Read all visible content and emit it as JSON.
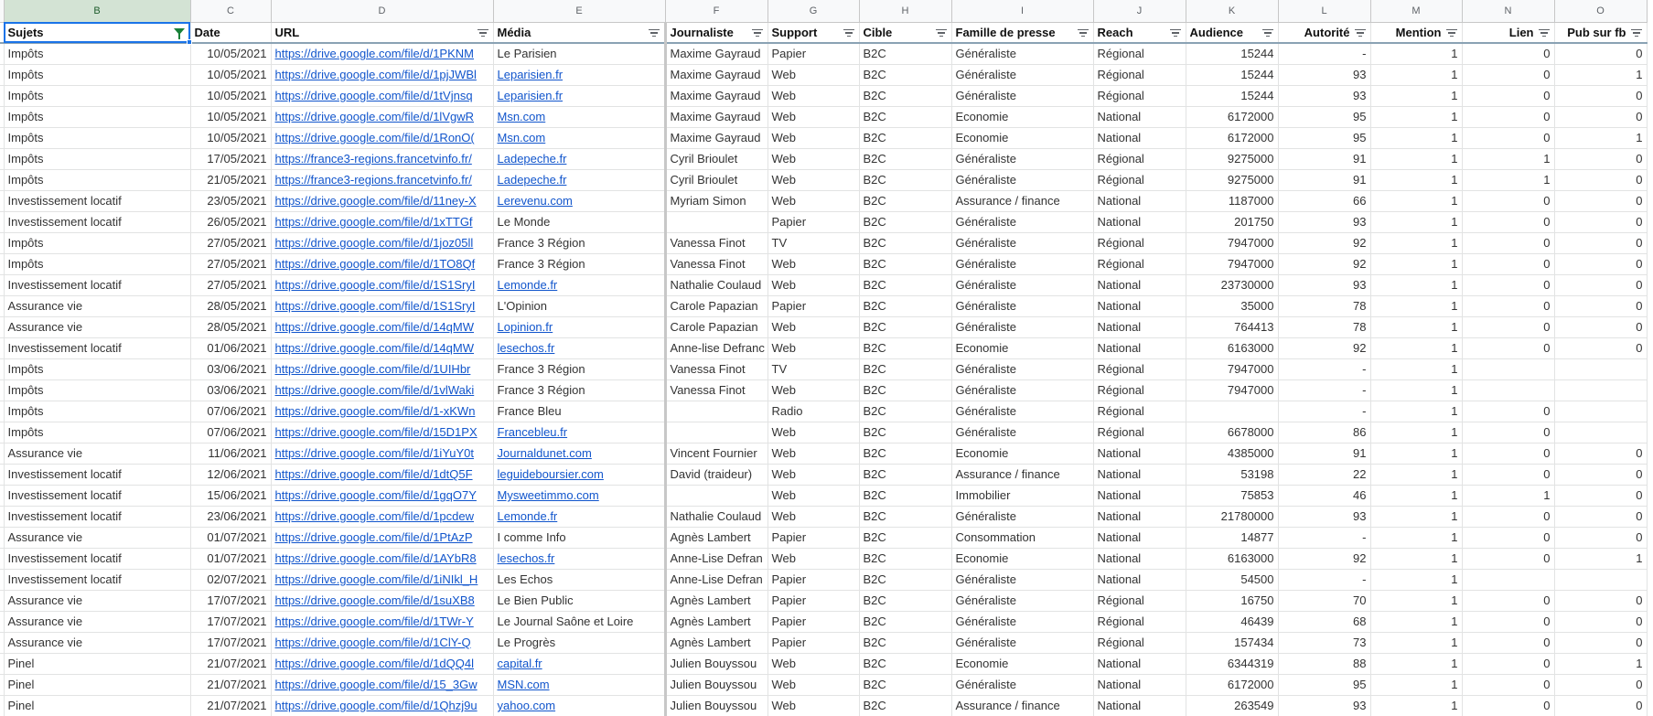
{
  "columns": [
    {
      "letter": "B",
      "header": "Sujets",
      "filter": "active"
    },
    {
      "letter": "C",
      "header": "Date",
      "filter": "none"
    },
    {
      "letter": "D",
      "header": "URL",
      "filter": "inactive"
    },
    {
      "letter": "E",
      "header": "Média",
      "filter": "inactive"
    },
    {
      "letter": "F",
      "header": "Journaliste",
      "filter": "inactive"
    },
    {
      "letter": "G",
      "header": "Support",
      "filter": "inactive"
    },
    {
      "letter": "H",
      "header": "Cible",
      "filter": "inactive"
    },
    {
      "letter": "I",
      "header": "Famille de presse",
      "filter": "inactive"
    },
    {
      "letter": "J",
      "header": "Reach",
      "filter": "inactive"
    },
    {
      "letter": "K",
      "header": "Audience",
      "filter": "inactive"
    },
    {
      "letter": "L",
      "header": "Autorité",
      "filter": "inactive"
    },
    {
      "letter": "M",
      "header": "Mention",
      "filter": "inactive"
    },
    {
      "letter": "N",
      "header": "Lien",
      "filter": "inactive"
    },
    {
      "letter": "O",
      "header": "Pub sur fb",
      "filter": "inactive"
    }
  ],
  "rows": [
    [
      "Impôts",
      "10/05/2021",
      "https://drive.google.com/file/d/1PKNM",
      "Le Parisien",
      "Maxime Gayraud",
      "Papier",
      "B2C",
      "Généraliste",
      "Régional",
      "15244",
      "-",
      "1",
      "0",
      "0"
    ],
    [
      "Impôts",
      "10/05/2021",
      "https://drive.google.com/file/d/1pjJWBl",
      "Leparisien.fr",
      "Maxime Gayraud",
      "Web",
      "B2C",
      "Généraliste",
      "Régional",
      "15244",
      "93",
      "1",
      "0",
      "1"
    ],
    [
      "Impôts",
      "10/05/2021",
      "https://drive.google.com/file/d/1tVjnsq",
      "Leparisien.fr",
      "Maxime Gayraud",
      "Web",
      "B2C",
      "Généraliste",
      "Régional",
      "15244",
      "93",
      "1",
      "0",
      "0"
    ],
    [
      "Impôts",
      "10/05/2021",
      "https://drive.google.com/file/d/1lVgwR",
      "Msn.com",
      "Maxime Gayraud",
      "Web",
      "B2C",
      "Economie",
      "National",
      "6172000",
      "95",
      "1",
      "0",
      "0"
    ],
    [
      "Impôts",
      "10/05/2021",
      "https://drive.google.com/file/d/1RonO(",
      "Msn.com",
      "Maxime Gayraud",
      "Web",
      "B2C",
      "Economie",
      "National",
      "6172000",
      "95",
      "1",
      "0",
      "1"
    ],
    [
      "Impôts",
      "17/05/2021",
      "https://france3-regions.francetvinfo.fr/",
      "Ladepeche.fr",
      "Cyril Brioulet",
      "Web",
      "B2C",
      "Généraliste",
      "Régional",
      "9275000",
      "91",
      "1",
      "1",
      "0"
    ],
    [
      "Impôts",
      "21/05/2021",
      "https://france3-regions.francetvinfo.fr/",
      "Ladepeche.fr",
      "Cyril Brioulet",
      "Web",
      "B2C",
      "Généraliste",
      "Régional",
      "9275000",
      "91",
      "1",
      "1",
      "0"
    ],
    [
      "Investissement locatif",
      "23/05/2021",
      "https://drive.google.com/file/d/11ney-X",
      "Lerevenu.com",
      "Myriam Simon",
      "Web",
      "B2C",
      "Assurance / finance",
      "National",
      "1187000",
      "66",
      "1",
      "0",
      "0"
    ],
    [
      "Investissement locatif",
      "26/05/2021",
      "https://drive.google.com/file/d/1xTTGf",
      "Le Monde",
      "",
      "Papier",
      "B2C",
      "Généraliste",
      "National",
      "201750",
      "93",
      "1",
      "0",
      "0"
    ],
    [
      "Impôts",
      "27/05/2021",
      "https://drive.google.com/file/d/1joz05ll",
      "France 3 Région",
      "Vanessa Finot",
      "TV",
      "B2C",
      "Généraliste",
      "Régional",
      "7947000",
      "92",
      "1",
      "0",
      "0"
    ],
    [
      "Impôts",
      "27/05/2021",
      "https://drive.google.com/file/d/1TO8Qf",
      "France 3 Région",
      "Vanessa Finot",
      "Web",
      "B2C",
      "Généraliste",
      "Régional",
      "7947000",
      "92",
      "1",
      "0",
      "0"
    ],
    [
      "Investissement locatif",
      "27/05/2021",
      "https://drive.google.com/file/d/1S1SryI",
      "Lemonde.fr",
      "Nathalie Coulaud",
      "Web",
      "B2C",
      "Généraliste",
      "National",
      "23730000",
      "93",
      "1",
      "0",
      "0"
    ],
    [
      "Assurance vie",
      "28/05/2021",
      "https://drive.google.com/file/d/1S1SryI",
      "L'Opinion",
      "Carole Papazian",
      "Papier",
      "B2C",
      "Généraliste",
      "National",
      "35000",
      "78",
      "1",
      "0",
      "0"
    ],
    [
      "Assurance vie",
      "28/05/2021",
      "https://drive.google.com/file/d/14qMW",
      "Lopinion.fr",
      "Carole Papazian",
      "Web",
      "B2C",
      "Généraliste",
      "National",
      "764413",
      "78",
      "1",
      "0",
      "0"
    ],
    [
      "Investissement locatif",
      "01/06/2021",
      "https://drive.google.com/file/d/14qMW",
      "lesechos.fr",
      "Anne-lise Defranc",
      "Web",
      "B2C",
      "Economie",
      "National",
      "6163000",
      "92",
      "1",
      "0",
      "0"
    ],
    [
      "Impôts",
      "03/06/2021",
      "https://drive.google.com/file/d/1UIHbr",
      "France 3 Région",
      "Vanessa Finot",
      "TV",
      "B2C",
      "Généraliste",
      "Régional",
      "7947000",
      "-",
      "1",
      "",
      ""
    ],
    [
      "Impôts",
      "03/06/2021",
      "https://drive.google.com/file/d/1vlWaki",
      "France 3 Région",
      "Vanessa Finot",
      "Web",
      "B2C",
      "Généraliste",
      "Régional",
      "7947000",
      "-",
      "1",
      "",
      ""
    ],
    [
      "Impôts",
      "07/06/2021",
      "https://drive.google.com/file/d/1-xKWn",
      "France Bleu",
      "",
      "Radio",
      "B2C",
      "Généraliste",
      "Régional",
      "",
      "-",
      "1",
      "0",
      ""
    ],
    [
      "Impôts",
      "07/06/2021",
      "https://drive.google.com/file/d/15D1PX",
      "Francebleu.fr",
      "",
      "Web",
      "B2C",
      "Généraliste",
      "Régional",
      "6678000",
      "86",
      "1",
      "0",
      ""
    ],
    [
      "Assurance vie",
      "11/06/2021",
      "https://drive.google.com/file/d/1iYuY0t",
      "Journaldunet.com",
      "Vincent Fournier",
      "Web",
      "B2C",
      "Economie",
      "National",
      "4385000",
      "91",
      "1",
      "0",
      "0"
    ],
    [
      "Investissement locatif",
      "12/06/2021",
      "https://drive.google.com/file/d/1dtQ5F",
      "leguideboursier.com",
      "David (traideur)",
      "Web",
      "B2C",
      "Assurance / finance",
      "National",
      "53198",
      "22",
      "1",
      "0",
      "0"
    ],
    [
      "Investissement locatif",
      "15/06/2021",
      "https://drive.google.com/file/d/1gqO7Y",
      "Mysweetimmo.com",
      "",
      "Web",
      "B2C",
      "Immobilier",
      "National",
      "75853",
      "46",
      "1",
      "1",
      "0"
    ],
    [
      "Investissement locatif",
      "23/06/2021",
      "https://drive.google.com/file/d/1pcdew",
      "Lemonde.fr",
      "Nathalie Coulaud",
      "Web",
      "B2C",
      "Généraliste",
      "National",
      "21780000",
      "93",
      "1",
      "0",
      "0"
    ],
    [
      "Assurance vie",
      "01/07/2021",
      "https://drive.google.com/file/d/1PtAzP",
      "I comme Info",
      "Agnès Lambert",
      "Papier",
      "B2C",
      "Consommation",
      "National",
      "14877",
      "-",
      "1",
      "0",
      "0"
    ],
    [
      "Investissement locatif",
      "01/07/2021",
      "https://drive.google.com/file/d/1AYbR8",
      "lesechos.fr",
      "Anne-Lise Defran",
      "Web",
      "B2C",
      "Economie",
      "National",
      "6163000",
      "92",
      "1",
      "0",
      "1"
    ],
    [
      "Investissement locatif",
      "02/07/2021",
      "https://drive.google.com/file/d/1iNIkl_H",
      "Les Echos",
      "Anne-Lise Defran",
      "Papier",
      "B2C",
      "Généraliste",
      "National",
      "54500",
      "-",
      "1",
      "",
      ""
    ],
    [
      "Assurance vie",
      "17/07/2021",
      "https://drive.google.com/file/d/1suXB8",
      "Le Bien Public",
      "Agnès Lambert",
      "Papier",
      "B2C",
      "Généraliste",
      "Régional",
      "16750",
      "70",
      "1",
      "0",
      "0"
    ],
    [
      "Assurance vie",
      "17/07/2021",
      "https://drive.google.com/file/d/1TWr-Y",
      "Le Journal Saône et Loire",
      "Agnès Lambert",
      "Papier",
      "B2C",
      "Généraliste",
      "Régional",
      "46439",
      "68",
      "1",
      "0",
      "0"
    ],
    [
      "Assurance vie",
      "17/07/2021",
      "https://drive.google.com/file/d/1ClY-Q",
      "Le Progrès",
      "Agnès Lambert",
      "Papier",
      "B2C",
      "Généraliste",
      "Régional",
      "157434",
      "73",
      "1",
      "0",
      "0"
    ],
    [
      "Pinel",
      "21/07/2021",
      "https://drive.google.com/file/d/1dQQ4l",
      "capital.fr",
      "Julien Bouyssou",
      "Web",
      "B2C",
      "Economie",
      "National",
      "6344319",
      "88",
      "1",
      "0",
      "1"
    ],
    [
      "Pinel",
      "21/07/2021",
      "https://drive.google.com/file/d/15_3Gw",
      "MSN.com",
      "Julien Bouyssou",
      "Web",
      "B2C",
      "Généraliste",
      "National",
      "6172000",
      "95",
      "1",
      "0",
      "0"
    ],
    [
      "Pinel",
      "21/07/2021",
      "https://drive.google.com/file/d/1Qhzj9u",
      "yahoo.com",
      "Julien Bouyssou",
      "Web",
      "B2C",
      "Assurance / finance",
      "National",
      "263549",
      "93",
      "1",
      "0",
      "0"
    ]
  ],
  "colors": {
    "accent": "#1a73e8",
    "link": "#1155cc",
    "filter_active": "#188038",
    "header_selected": "#d3e3d4"
  }
}
